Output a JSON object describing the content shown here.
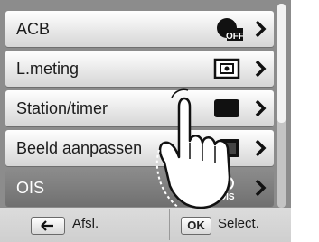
{
  "menu": {
    "items": [
      {
        "label": "ACB",
        "icon": "acb-off-icon",
        "icon_text": "OFF"
      },
      {
        "label": "L.meting",
        "icon": "metering-icon"
      },
      {
        "label": "Station/timer",
        "icon": "single-shot-icon"
      },
      {
        "label": "Beeld aanpassen",
        "icon": "image-adjust-icon"
      },
      {
        "label": "OIS",
        "icon": "ois-icon",
        "icon_text": "OIS"
      }
    ]
  },
  "bottom_bar": {
    "back_label": "Afsl.",
    "ok_key": "OK",
    "select_label": "Select."
  },
  "colors": {
    "screen_bg": "#8c8c8c",
    "item_light": "#f0f0f0",
    "item_dark": "#7d7d7d",
    "bar_bg": "#d6d6d6"
  }
}
